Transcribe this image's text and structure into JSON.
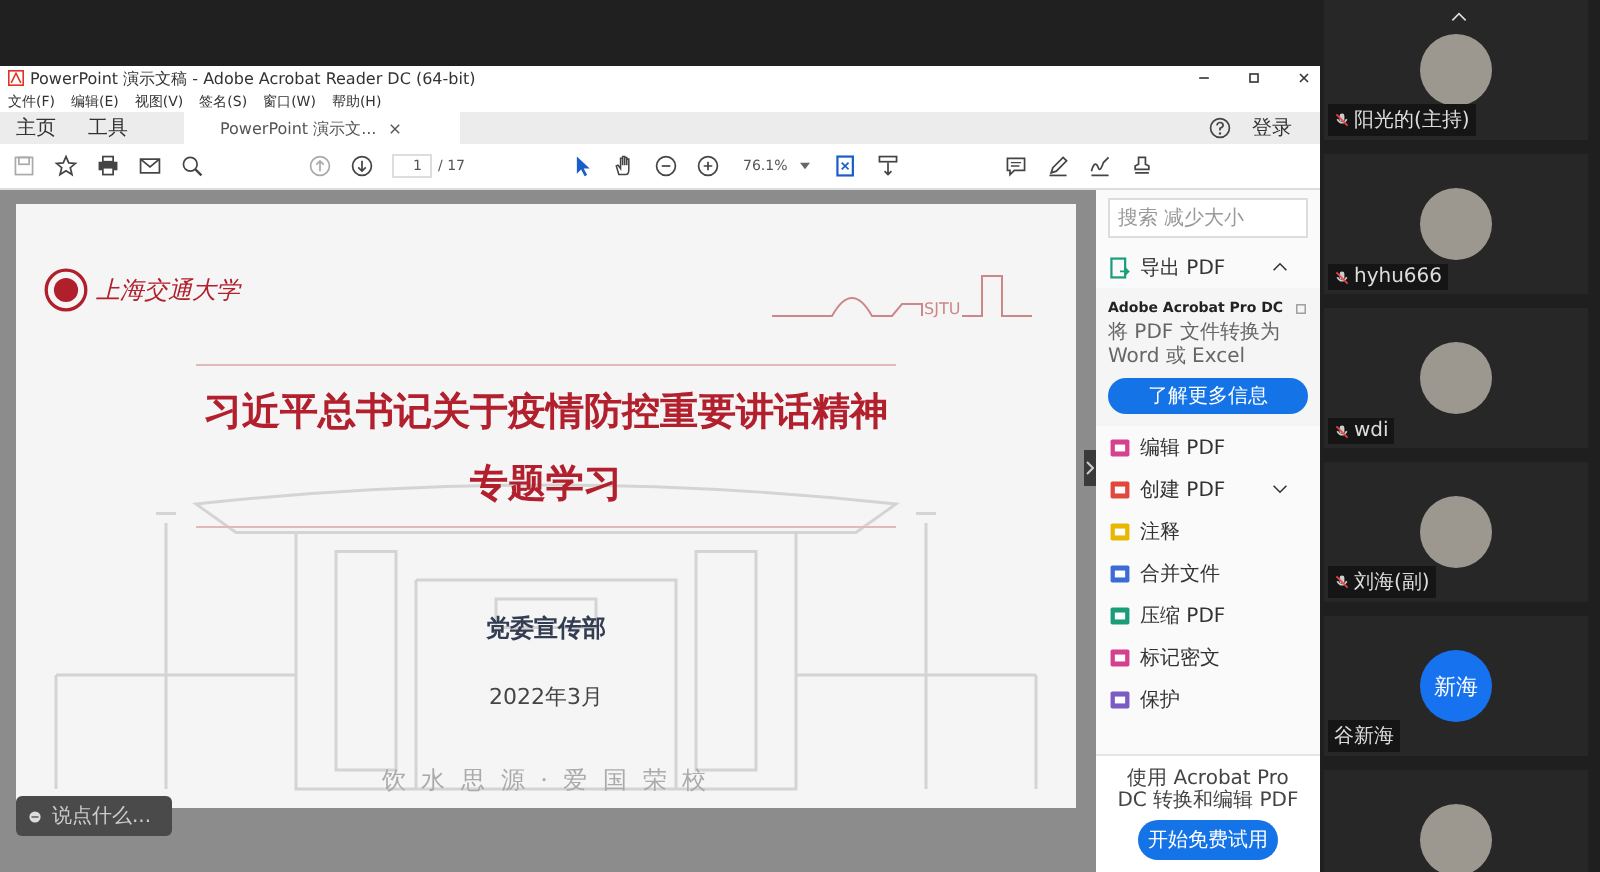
{
  "window": {
    "title": "PowerPoint 演示文稿 - Adobe Acrobat Reader DC (64-bit)"
  },
  "menu": [
    "文件(F)",
    "编辑(E)",
    "视图(V)",
    "签名(S)",
    "窗口(W)",
    "帮助(H)"
  ],
  "tabs": [
    {
      "label": "主页",
      "selected": false
    },
    {
      "label": "工具",
      "selected": false
    },
    {
      "label": "PowerPoint 演示文...",
      "selected": true
    }
  ],
  "sign_in": "登录",
  "toolbar": {
    "page": "1",
    "page_total": "/ 17",
    "zoom": "76.1%"
  },
  "slide": {
    "logo": "上海交通大学",
    "skyline_text": "SJTU",
    "title": "习近平总书记关于疫情防控重要讲话精神",
    "subtitle": "专题学习",
    "department": "党委宣传部",
    "date": "2022年3月",
    "motto": "饮 水 思 源 · 爱 国 荣 校"
  },
  "chat_input": {
    "placeholder": "说点什么..."
  },
  "tools_panel": {
    "search": {
      "placeholder": "搜索 减少大小"
    },
    "export": {
      "label": "导出 PDF",
      "expanded": true
    },
    "promo": {
      "title": "Adobe Acrobat Pro DC",
      "text": "将 PDF 文件转换为 Word 或 Excel",
      "button": "了解更多信息"
    },
    "items": [
      {
        "label": "编辑 PDF",
        "color": "#d6418f",
        "has_submenu": false
      },
      {
        "label": "创建 PDF",
        "color": "#e0483c",
        "has_submenu": true
      },
      {
        "label": "注释",
        "color": "#e8b800",
        "has_submenu": false
      },
      {
        "label": "合并文件",
        "color": "#3d6bd6",
        "has_submenu": false
      },
      {
        "label": "压缩 PDF",
        "color": "#1a9e7a",
        "has_submenu": false
      },
      {
        "label": "标记密文",
        "color": "#d6418f",
        "has_submenu": false
      },
      {
        "label": "保护",
        "color": "#7b5bc6",
        "has_submenu": false
      }
    ],
    "footer": {
      "text": "使用 Acrobat Pro DC 转换和编辑 PDF",
      "button": "开始免费试用"
    }
  },
  "participants": [
    {
      "kind": "photo",
      "name": "阳光的(主持)",
      "muted": true
    },
    {
      "kind": "photo",
      "name": "hyhu666",
      "muted": true
    },
    {
      "kind": "photo",
      "name": "wdi",
      "muted": true
    },
    {
      "kind": "photo",
      "name": "刘海(副)",
      "muted": true
    },
    {
      "kind": "initials",
      "initials": "新海",
      "name": "谷新海"
    },
    {
      "kind": "photo"
    }
  ]
}
